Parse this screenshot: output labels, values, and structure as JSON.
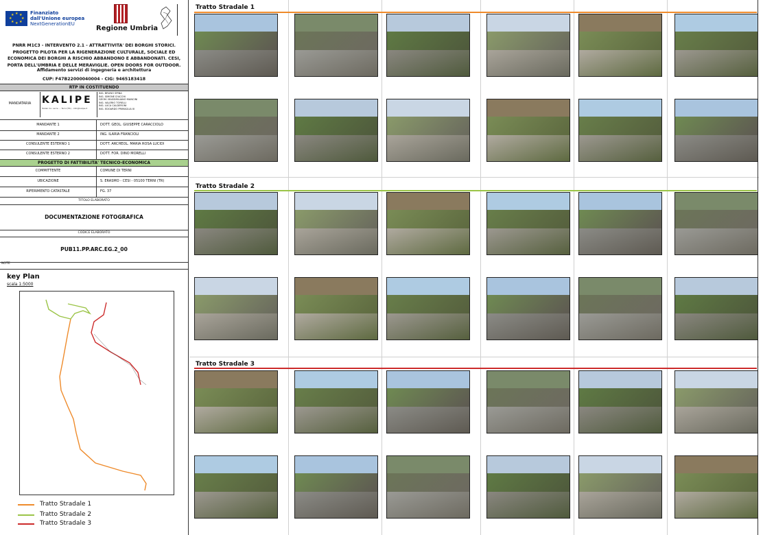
{
  "header": {
    "eu_line1": "Finanziato",
    "eu_line2": "dall'Unione europea",
    "eu_line3": "NextGenerationEU",
    "region": "Regione Umbria",
    "project_description": "PNRR M1C3 - INTERVENTO 2.1 - ATTRATTIVITA' DEI BORGHI STORICI. PROGETTO PILOTA PER LA RIGENERAZIONE CULTURALE, SOCIALE ED ECONOMICA DEI BORGHI A RISCHIO ABBANDONO E ABBANDONATI. CESI, PORTA DELL'UMBRIA E DELLE MERAVIGLIE. OPEN DOORS FOR OUTDOOR.",
    "assignment": "Affidamento servizi di ingegneria e architettura",
    "cup": "CUP: F47B22000040004 - CIG: 9465183418"
  },
  "rtp": {
    "title": "RTP IN COSTITUENDO",
    "mandataria_label": "MANDATARIA",
    "firm_logo": "KALIPE",
    "firm_details": "Italian Co. Lerre ... Terni (TR) - info@kalipe.it",
    "members": [
      "ING. BRUNO SPINA",
      "ING. SIMONE D'ACCHI",
      "GEOM. MASSIMILIANO MANCINI",
      "ING. VALERIO TORELLI",
      "ING. LUCA CALDERONI",
      "ING. EDOARDO PRIMAGLIA III"
    ],
    "rows": [
      {
        "label": "MANDANTE 1",
        "value": "DOTT. GEOL. GIUSEPPE CARACCIOLO"
      },
      {
        "label": "MANDANTE 2",
        "value": "ING. ILARIA FRANCIOLI"
      },
      {
        "label": "CONSULENTE ESTERNO 1",
        "value": "DOTT. ARCHEOL. MARIA ROSA LUCIDI"
      },
      {
        "label": "CONSULENTE ESTERNO 2",
        "value": "DOTT. FOR. DINO MORELLI"
      }
    ]
  },
  "pfte": {
    "title": "PROGETTO DI FATTIBILITA' TECNICO-ECONOMICA",
    "rows": [
      {
        "label": "COMMITTENTE",
        "value": "COMUNE DI TERNI"
      },
      {
        "label": "UBICAZIONE",
        "value": "S. ERASMO - CESI - 05100 TERNI (TR)"
      },
      {
        "label": "RIFERIMENTO CATASTALE",
        "value": "FG. 37"
      }
    ],
    "title_label": "TITOLO ELABORATO",
    "document_title": "DOCUMENTAZIONE FOTOGRAFICA",
    "code_label": "CODICE ELABORATO",
    "document_code": "PUB11.PP.ARC.EG.2_00",
    "note_label": "NOTE"
  },
  "keyplan": {
    "title": "key Plan",
    "scale": "scala 1:5000",
    "legend": [
      {
        "label": "Tratto Stradale 1",
        "color": "#ee8a2a"
      },
      {
        "label": "Tratto Stradale 2",
        "color": "#9bc447"
      },
      {
        "label": "Tratto Stradale 3",
        "color": "#cc2a2a"
      }
    ]
  },
  "sections": [
    {
      "title": "Tratto Stradale 1",
      "color": "#ee8a2a"
    },
    {
      "title": "Tratto Stradale 2",
      "color": "#9bc447"
    },
    {
      "title": "Tratto Stradale 3",
      "color": "#cc2a2a"
    }
  ],
  "colors": {
    "rtp_bar": "#c8c8c8",
    "pfte_bar": "#a9d18e",
    "eu_blue": "#0f3f9c"
  }
}
